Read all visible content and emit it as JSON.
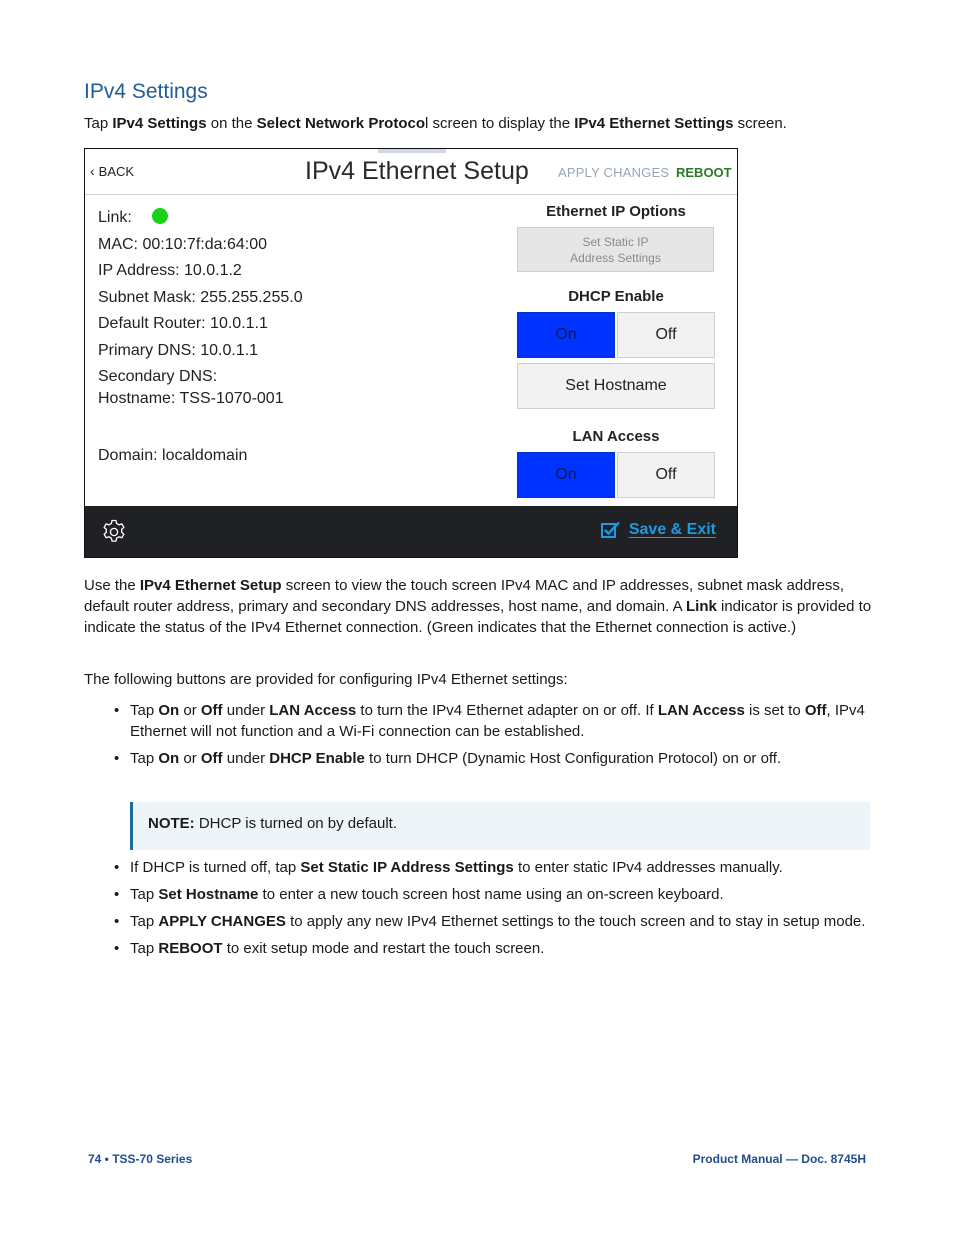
{
  "section": {
    "title": "IPv4 Settings",
    "intro": {
      "t1": "Tap ",
      "b1": "IPv4 Settings",
      "t2": " on the ",
      "b2": "Select Network Protoco",
      "t3": "l screen to display the ",
      "b3": "IPv4 Ethernet Settings",
      "t4": " screen."
    }
  },
  "device": {
    "back_label": "BACK",
    "title": "IPv4 Ethernet Setup",
    "apply_label": "APPLY CHANGES",
    "reboot_label": "REBOOT",
    "info": {
      "link_label": "Link:",
      "link_status": "active",
      "link_color": "#19d319",
      "mac": "MAC: 00:10:7f:da:64:00",
      "ip": "IP Address: 10.0.1.2",
      "subnet": "Subnet Mask: 255.255.255.0",
      "router": "Default Router: 10.0.1.1",
      "primary_dns": "Primary DNS: 10.0.1.1",
      "secondary_dns": "Secondary DNS:",
      "hostname": "Hostname: TSS-1070-001",
      "domain": "Domain: localdomain"
    },
    "options": {
      "heading": "Ethernet IP Options",
      "static_btn_line1": "Set Static IP",
      "static_btn_line2": "Address Settings",
      "dhcp_heading": "DHCP Enable",
      "dhcp_on": "On",
      "dhcp_off": "Off",
      "dhcp_selected": "On",
      "hostname_btn": "Set Hostname",
      "lan_heading": "LAN Access",
      "lan_on": "On",
      "lan_off": "Off",
      "lan_selected": "On"
    },
    "footer": {
      "settings_icon": "gear-icon",
      "save_exit_label": "Save & Exit",
      "save_icon": "checkbox-checked-icon"
    },
    "colors": {
      "toggle_on": "#0033ff",
      "reboot": "#2a7a2a",
      "apply": "#9aa6b2",
      "save_exit": "#1e9ae0"
    }
  },
  "body": {
    "p1": {
      "t1": "Use the ",
      "b1": "IPv4 Ethernet Setup",
      "t2": " screen to view the touch screen IPv4 MAC and IP addresses, subnet mask address, default router address, primary and secondary DNS addresses, host name, and domain. A ",
      "b2": "Link",
      "t3": " indicator is provided to indicate the status of the IPv4 Ethernet connection. (Green indicates that the Ethernet connection is active.)"
    },
    "p2": "The following buttons are provided for configuring IPv4 Ethernet settings:",
    "bullet1": {
      "t1": "Tap ",
      "b1": "On",
      "t2": " or ",
      "b2": "Off",
      "t3": " under ",
      "b3": "LAN Access",
      "t4": " to turn the IPv4 Ethernet adapter on or off. If ",
      "b4": "LAN Access",
      "t5": " is set to ",
      "b5": "Off",
      "t6": ", IPv4 Ethernet will not function and a Wi-Fi connection can be established."
    },
    "bullet2": {
      "t1": "Tap ",
      "b1": "On",
      "t2": " or ",
      "b2": "Off",
      "t3": " under ",
      "b3": "DHCP Enable",
      "t4": " to turn DHCP (Dynamic Host Configuration Protocol) on or off."
    },
    "note": {
      "label": "NOTE:",
      "text": " DHCP is turned on by default."
    },
    "bullet3": {
      "t1": "If DHCP is turned off, tap ",
      "b1": "Set Static IP Address Settings",
      "t2": " to enter static IPv4 addresses manually."
    },
    "bullet4": {
      "t1": "Tap ",
      "b1": "Set Hostname",
      "t2": " to enter a new touch screen host name using an on-screen keyboard."
    },
    "bullet5": {
      "t1": "Tap ",
      "b1": "APPLY CHANGES",
      "t2": " to apply any new IPv4 Ethernet settings to the touch screen and to stay in setup mode."
    },
    "bullet6": {
      "t1": "Tap ",
      "b1": "REBOOT",
      "t2": " to exit setup mode and restart the touch screen."
    }
  },
  "footer": {
    "left": "74 • TSS-70 Series",
    "right": "Product Manual — Doc. 8745H"
  }
}
